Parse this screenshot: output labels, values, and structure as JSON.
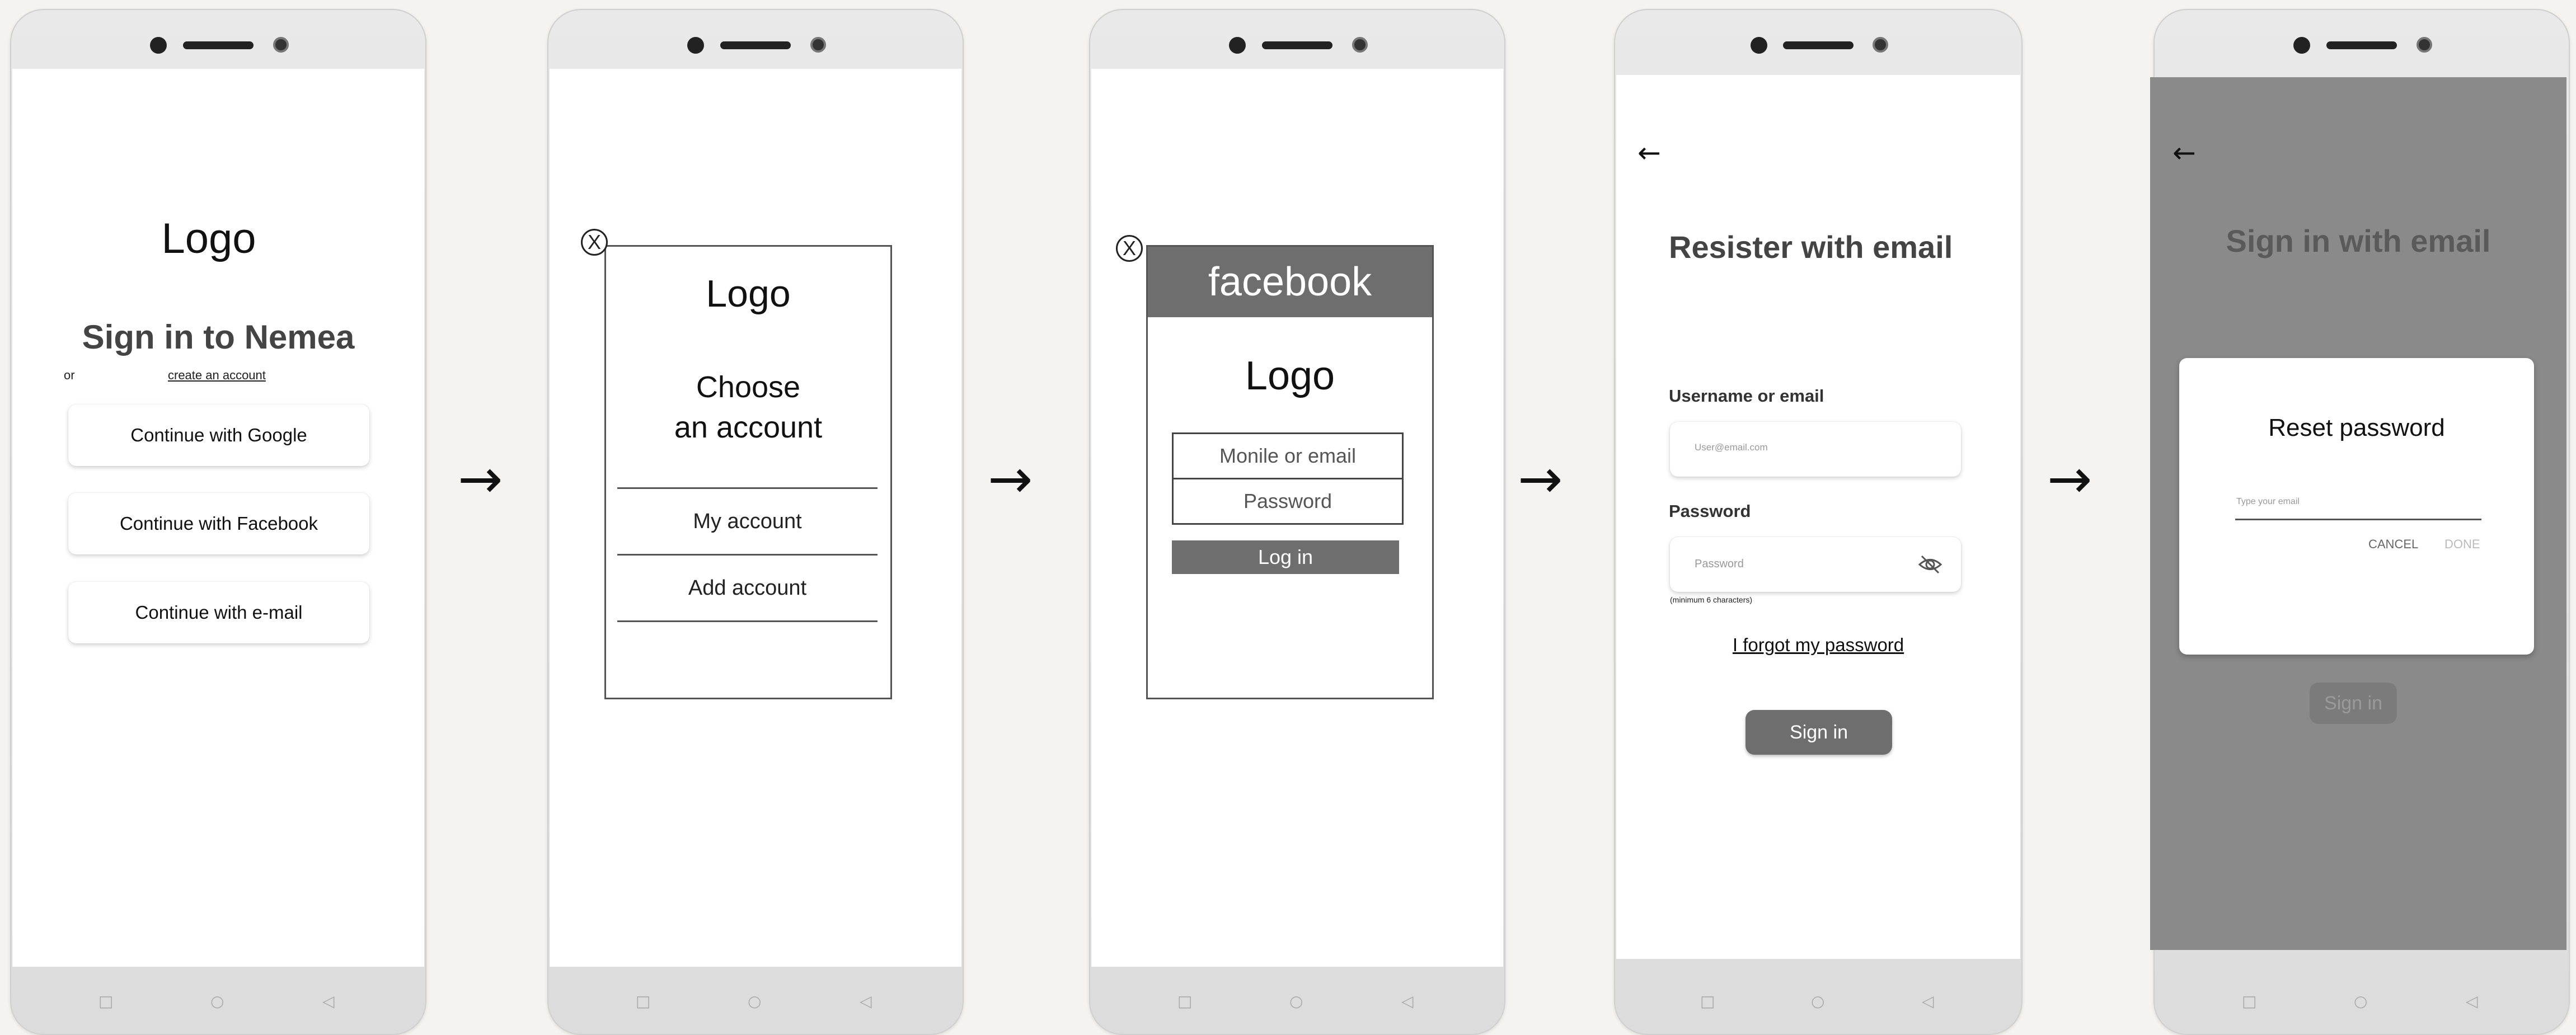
{
  "colors": {
    "background": "#f4f3f0",
    "dark_button": "#6e6e6e",
    "overlay": "#8a8a8a"
  },
  "flow_arrow": "→",
  "nav_icons": {
    "square": "□",
    "circle": "○",
    "back": "◁"
  },
  "screen1": {
    "logo": "Logo",
    "title": "Sign in to Nemea",
    "or": "or",
    "create_account": "create an account",
    "google": "Continue with Google",
    "facebook": "Continue with Facebook",
    "email": "Continue with e-mail"
  },
  "screen2": {
    "close": "X",
    "logo": "Logo",
    "choose_line1": "Choose",
    "choose_line2": "an account",
    "my_account": "My account",
    "add_account": "Add account"
  },
  "screen3": {
    "close": "X",
    "header": "facebook",
    "logo": "Logo",
    "mobile_placeholder": "Monile or email",
    "password_placeholder": "Password",
    "login": "Log in"
  },
  "screen4": {
    "back": "←",
    "title": "Resister with email",
    "username_label": "Username or email",
    "username_placeholder": "User@email.com",
    "password_label": "Password",
    "password_placeholder": "Password",
    "hint": "(minimum 6 characters)",
    "forgot": "I forgot my password",
    "sign_in": "Sign in"
  },
  "screen5": {
    "back": "←",
    "title": "Sign in with email",
    "dialog_title": "Reset password",
    "email_placeholder": "Type your email",
    "cancel": "CANCEL",
    "done": "DONE",
    "sign_in": "Sign in"
  }
}
